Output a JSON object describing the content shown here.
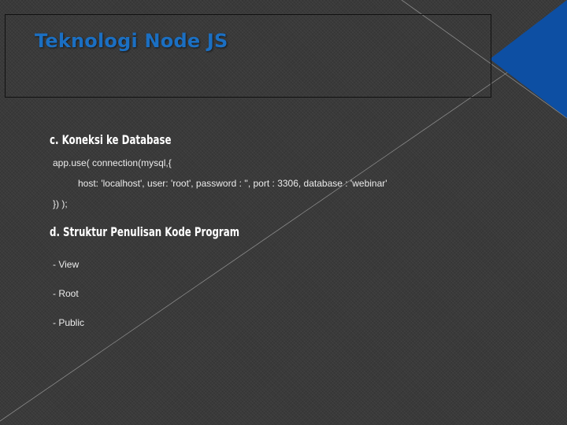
{
  "slide": {
    "title": "Teknologi Node JS",
    "section_c": {
      "heading": "c. Koneksi ke Database",
      "code_lines": [
        "app.use( connection(mysql,{",
        "host: 'localhost', user: 'root', password : '', port : 3306, database : 'webinar'",
        "})  );"
      ]
    },
    "section_d": {
      "heading": "d. Struktur Penulisan Kode Program",
      "items": [
        "- View",
        "- Root",
        "- Public"
      ]
    }
  },
  "colors": {
    "background": "#3a3a3a",
    "title": "#1b6fc2",
    "accent_triangle": "#0d4fa3",
    "text": "#ececec"
  }
}
